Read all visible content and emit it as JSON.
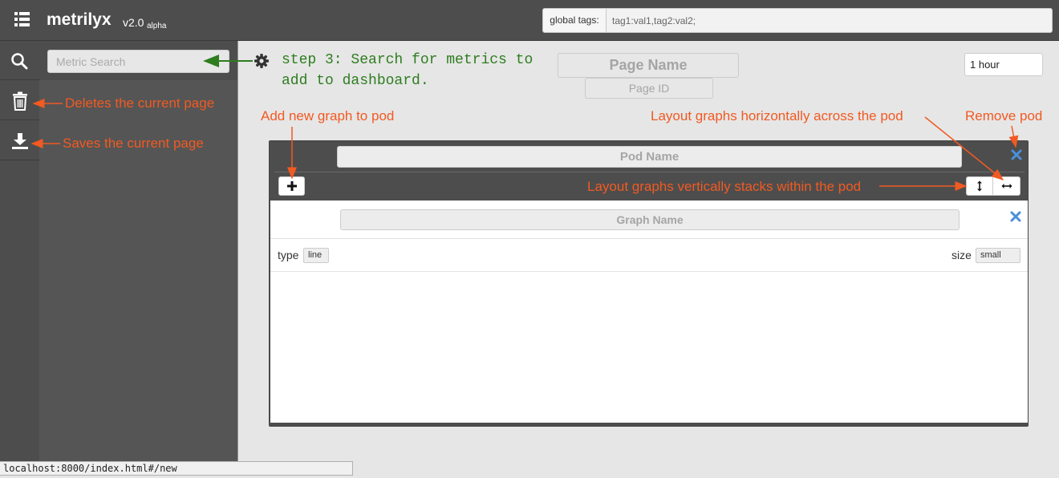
{
  "app": {
    "name": "metrilyx",
    "version": "v2.0",
    "stage": "alpha"
  },
  "global_tags": {
    "label": "global tags:",
    "value": "tag1:val1,tag2:val2;"
  },
  "sidebar": {
    "search_placeholder": "Metric Search"
  },
  "page": {
    "name_placeholder": "Page Name",
    "id_placeholder": "Page ID",
    "time_range": "1 hour"
  },
  "pod": {
    "name_placeholder": "Pod Name",
    "graph": {
      "name_placeholder": "Graph Name",
      "type_label": "type",
      "type_value": "line",
      "size_label": "size",
      "size_value": "small"
    }
  },
  "annotations": {
    "step3_line1": "step 3: Search for metrics to",
    "step3_line2": "add to dashboard.",
    "delete_page": "Deletes the current page",
    "save_page": "Saves the current page",
    "add_graph": "Add new graph to pod",
    "layout_horizontal": "Layout graphs horizontally across the pod",
    "remove_pod": "Remove pod",
    "layout_vertical": "Layout graphs vertically stacks within the pod"
  },
  "status_bar": {
    "url": "localhost:8000/index.html#/new"
  },
  "colors": {
    "annotation": "#f15a22",
    "step_annotation": "#2e7d1f",
    "close_icon": "#4a90d9",
    "chrome": "#4d4d4d"
  }
}
